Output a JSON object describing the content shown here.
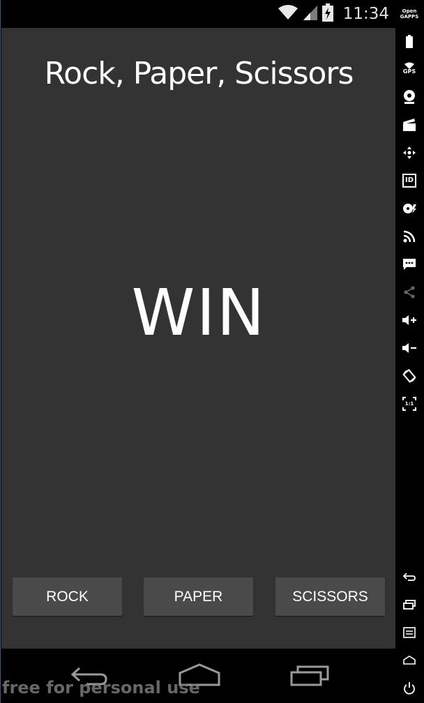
{
  "status_bar": {
    "time": "11:34",
    "icons": [
      "wifi-icon",
      "signal-icon",
      "battery-charging-icon"
    ]
  },
  "app": {
    "title": "Rock, Paper, Scissors",
    "result": "WIN",
    "buttons": {
      "rock": "ROCK",
      "paper": "PAPER",
      "scissors": "SCISSORS"
    },
    "background": "#333333",
    "button_color": "#4a4a4a"
  },
  "nav_bar": {
    "icons": [
      "back-icon",
      "home-icon",
      "recent-apps-icon"
    ]
  },
  "watermark": "free for personal use",
  "side_toolbar": {
    "open_gapps_label": "Open GAPPS",
    "gps_label": "GPS",
    "id_label": "ID",
    "scale_label": "1:1",
    "icons": [
      "battery-icon",
      "gps-icon",
      "camera-icon",
      "clapper-icon",
      "move-icon",
      "id-icon",
      "disk-icon",
      "rss-icon",
      "sms-icon",
      "share-icon",
      "volume-up-icon",
      "volume-down-icon",
      "rotate-icon",
      "pixel-scale-icon",
      "back-icon",
      "recent-apps-icon",
      "menu-icon",
      "home-icon",
      "power-icon"
    ]
  }
}
